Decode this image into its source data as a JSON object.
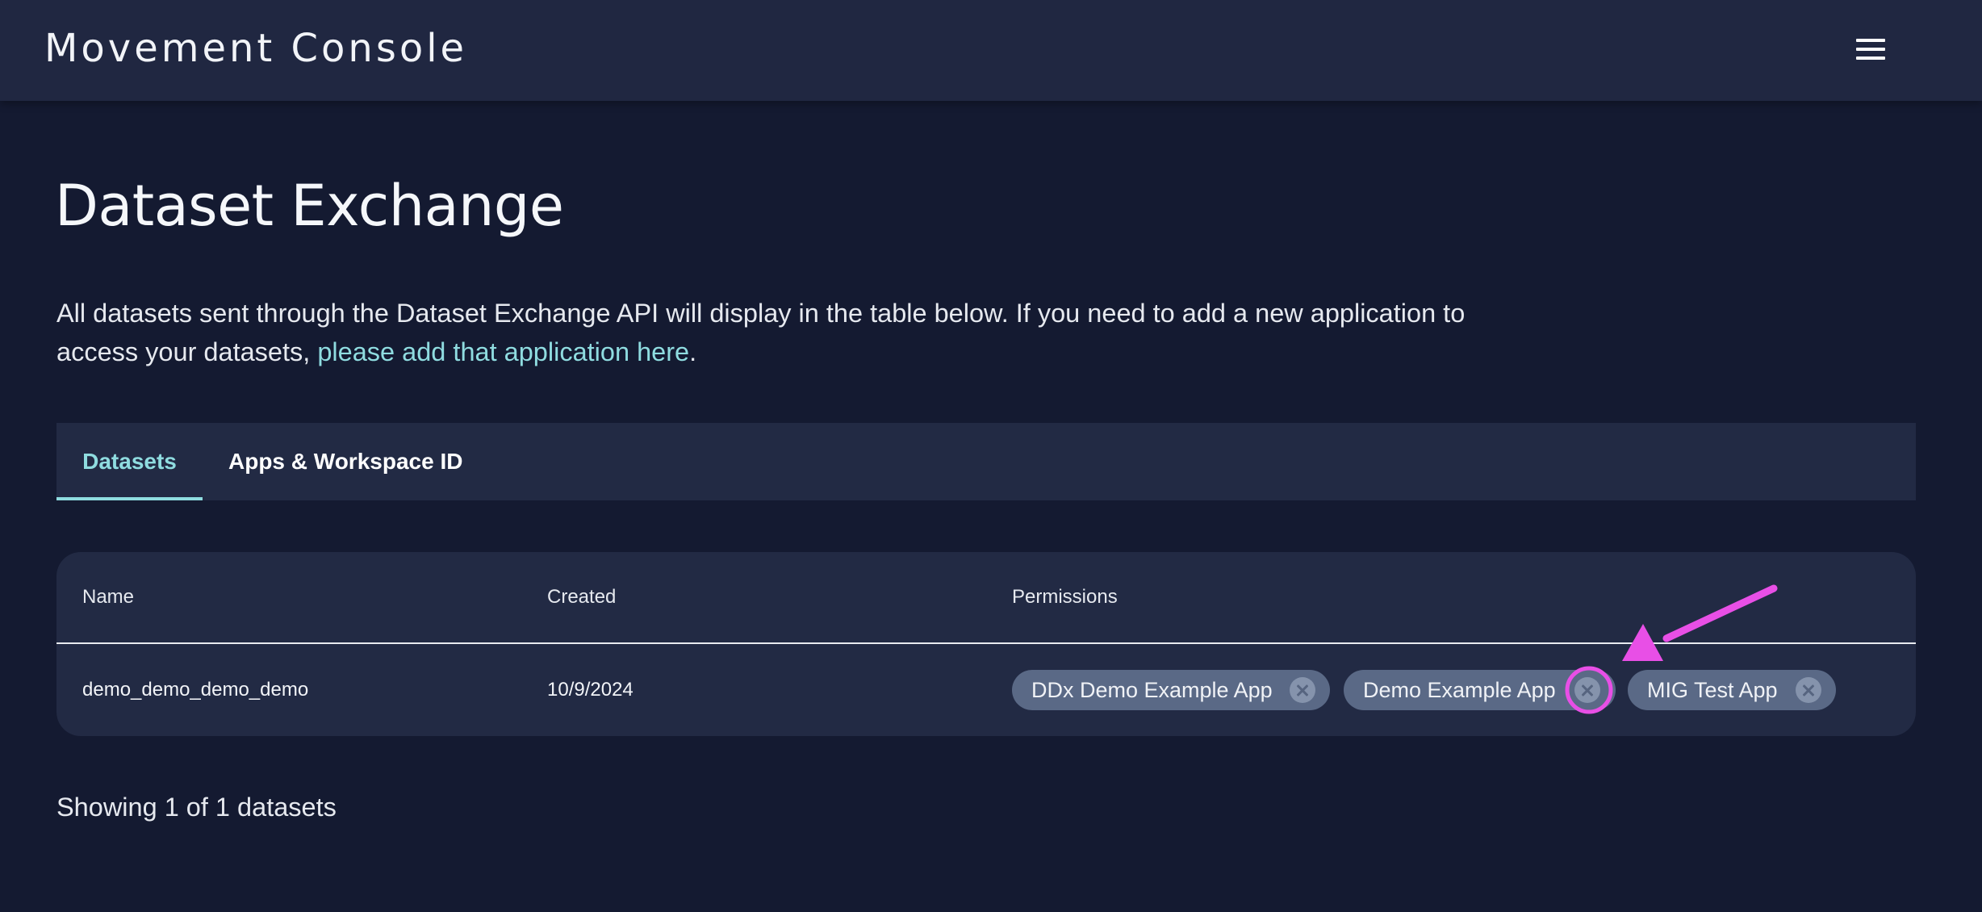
{
  "header": {
    "app_title": "Movement Console",
    "menu_icon": "hamburger-menu-icon"
  },
  "page": {
    "title": "Dataset Exchange",
    "description_text": "All datasets sent through the Dataset Exchange API will display in the table below. If you need to add a new application to access your datasets, ",
    "description_link": "please add that application here",
    "description_suffix": "."
  },
  "tabs": [
    {
      "label": "Datasets",
      "active": true
    },
    {
      "label": "Apps & Workspace ID",
      "active": false
    }
  ],
  "table": {
    "columns": [
      "Name",
      "Created",
      "Permissions"
    ],
    "rows": [
      {
        "name": "demo_demo_demo_demo",
        "created": "10/9/2024",
        "permissions": [
          "DDx Demo Example App",
          "Demo Example App",
          "MIG Test App"
        ]
      }
    ]
  },
  "footer": {
    "count_text": "Showing 1 of 1 datasets"
  },
  "colors": {
    "background": "#141a31",
    "header_bg": "#202741",
    "card_bg": "#222a44",
    "accent": "#8fdce0",
    "chip_bg": "#5a6986",
    "annotation": "#e84fe6"
  }
}
